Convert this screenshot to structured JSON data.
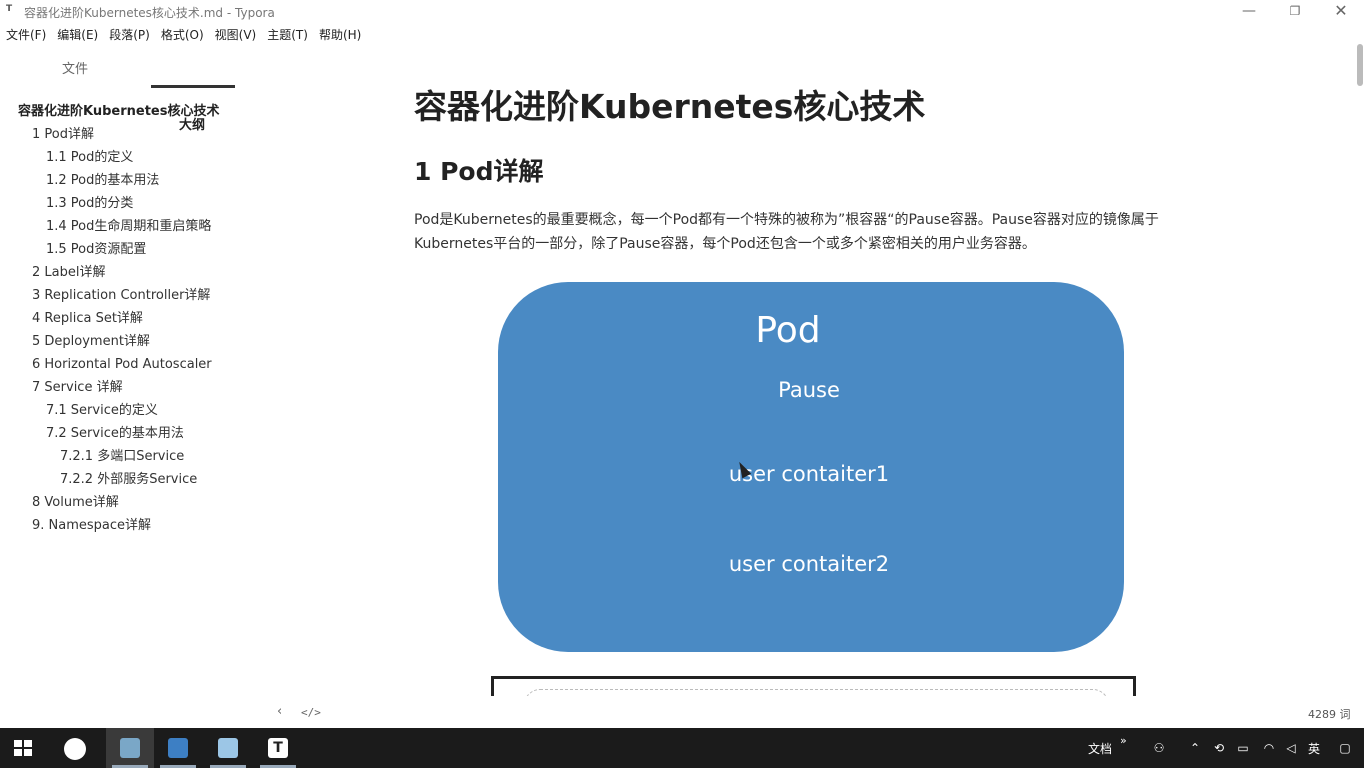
{
  "window": {
    "title": "容器化进阶Kubernetes核心技术.md - Typora",
    "app_icon": "T",
    "minimize": "—",
    "maximize": "❐",
    "close": "✕"
  },
  "menu": [
    "文件(F)",
    "编辑(E)",
    "段落(P)",
    "格式(O)",
    "视图(V)",
    "主题(T)",
    "帮助(H)"
  ],
  "sidebar": {
    "tabs": {
      "files": "文件",
      "outline": "大纲"
    },
    "outline": [
      {
        "text": "容器化进阶Kubernetes核心技术",
        "level": 1
      },
      {
        "text": "1 Pod详解",
        "level": 2
      },
      {
        "text": "1.1 Pod的定义",
        "level": 3
      },
      {
        "text": "1.2 Pod的基本用法",
        "level": 3
      },
      {
        "text": "1.3 Pod的分类",
        "level": 3
      },
      {
        "text": "1.4 Pod生命周期和重启策略",
        "level": 3
      },
      {
        "text": "1.5 Pod资源配置",
        "level": 3
      },
      {
        "text": "2 Label详解",
        "level": 2
      },
      {
        "text": "3 Replication Controller详解",
        "level": 2
      },
      {
        "text": "4 Replica Set详解",
        "level": 2
      },
      {
        "text": "5 Deployment详解",
        "level": 2
      },
      {
        "text": "6 Horizontal Pod Autoscaler",
        "level": 2
      },
      {
        "text": "7 Service 详解",
        "level": 2
      },
      {
        "text": "7.1 Service的定义",
        "level": 3
      },
      {
        "text": "7.2 Service的基本用法",
        "level": 3
      },
      {
        "text": "7.2.1 多端口Service",
        "level": 4
      },
      {
        "text": "7.2.2 外部服务Service",
        "level": 4
      },
      {
        "text": "8 Volume详解",
        "level": 2
      },
      {
        "text": "9. Namespace详解",
        "level": 2
      }
    ]
  },
  "document": {
    "title": "容器化进阶Kubernetes核心技术",
    "h2": "1 Pod详解",
    "paragraph": "Pod是Kubernetes的最重要概念，每一个Pod都有一个特殊的被称为”根容器“的Pause容器。Pause容器对应的镜像属于Kubernetes平台的一部分，除了Pause容器，每个Pod还包含一个或多个紧密相关的用户业务容器。",
    "figure": {
      "title": "Pod",
      "pause": "Pause",
      "container1": "user contaiter1",
      "container2": "user contaiter2",
      "fill_color": "#4a8ac4"
    }
  },
  "footer": {
    "prev": "‹",
    "source": "</>",
    "word_count": "4289 词"
  },
  "taskbar": {
    "tray_text": "文档",
    "ime": "英",
    "more": "»"
  }
}
